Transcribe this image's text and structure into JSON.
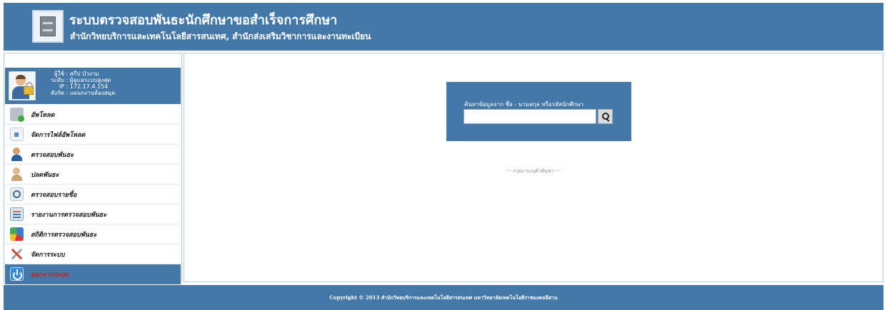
{
  "header": {
    "title": "ระบบตรวจสอบพันธะนักศึกษาขอสำเร็จการศึกษา",
    "subtitle": "สำนักวิทยบริการและเทคโนโลยีสารสนเทศ, สำนักส่งเสริมวิชาการและงานทะเบียน",
    "logo_icon": "file-cabinet-icon"
  },
  "user": {
    "avatar_icon": "user-lock-icon",
    "fields": [
      {
        "key": "ผู้ใช้",
        "value": "สกีป บัวงาม"
      },
      {
        "key": "ระดับ",
        "value": "ผู้ดูแลระบบสูงสุด"
      },
      {
        "key": "IP",
        "value": "172.17.4.154"
      },
      {
        "key": "สังกัด",
        "value": "แผนกงานห้องสมุด"
      }
    ]
  },
  "menu": [
    {
      "label": "อัพโหลด",
      "icon": "upload-icon"
    },
    {
      "label": "จัดการไฟล์อัพโหลด",
      "icon": "file-manage-icon"
    },
    {
      "label": "ตรวจสอบพันธะ",
      "icon": "user-alert-icon"
    },
    {
      "label": "ปลดพันธะ",
      "icon": "user-release-icon"
    },
    {
      "label": "ตรวจสอบรายชื่อ",
      "icon": "search-list-icon"
    },
    {
      "label": "รายงานการตรวจสอบพันธะ",
      "icon": "report-icon"
    },
    {
      "label": "สถิติการตรวจสอบพันธะ",
      "icon": "pie-chart-icon"
    },
    {
      "label": "จัดการระบบ",
      "icon": "tools-icon"
    },
    {
      "label": "ออกจากระบบ",
      "icon": "power-icon"
    }
  ],
  "search": {
    "label": "ค้นหาข้อมูลจาก ชื่อ - นามสกุล หรือรหัสนักศึกษา",
    "placeholder": "",
    "value": "",
    "button_icon": "search-icon"
  },
  "hint": "--- กรุณาระบุคำค้นหา ---",
  "footer": "Copyright © 2013 สำนักวิทยบริการและเทคโนโลยีสารสนเทศ มหาวิทยาลัยเทคโนโลยีราชมงคลอีสาน",
  "colors": {
    "brand": "#4478a8",
    "logout_text": "#e01818"
  }
}
